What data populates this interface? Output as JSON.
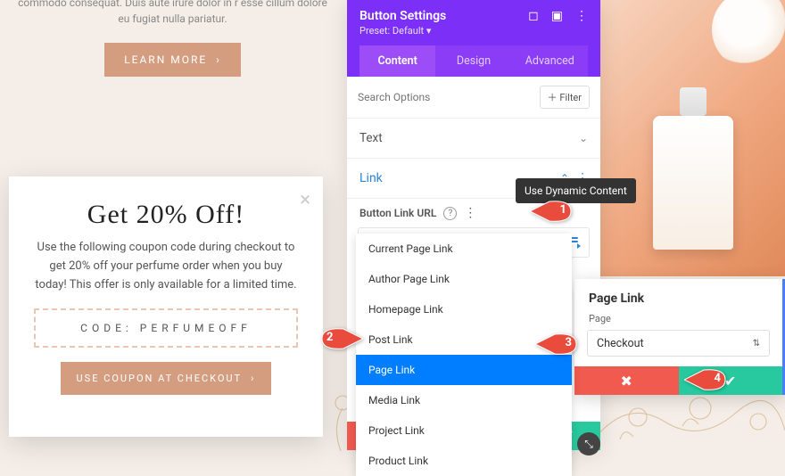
{
  "banner": {
    "lorem": "commodo consequat. Duis aute irure dolor in r\nesse cillum dolore eu fugiat nulla pariatur.",
    "learn_more_label": "LEARN MORE",
    "learn_more_arrow": "›"
  },
  "promo": {
    "title": "Get 20% Off!",
    "body": "Use the following coupon code during checkout to get 20% off your perfume order when you buy today! This offer is only available for a limited time.",
    "coupon_code": "CODE: PERFUMEOFF",
    "cta_label": "USE COUPON AT CHECKOUT",
    "cta_arrow": "›"
  },
  "panel": {
    "title": "Button Settings",
    "preset": "Preset: Default ▾",
    "tabs": {
      "content": "Content",
      "design": "Design",
      "advanced": "Advanced"
    },
    "search_placeholder": "Search Options",
    "filter_label": "＋ Filter",
    "options": {
      "text": "Text",
      "link": "Link"
    },
    "url_label": "Button Link URL",
    "tooltip": "Use Dynamic Content",
    "dropdown": [
      "Current Page Link",
      "Author Page Link",
      "Homepage Link",
      "Post Link",
      "Page Link",
      "Media Link",
      "Project Link",
      "Product Link"
    ],
    "dropdown_selected_index": 4
  },
  "page_link_panel": {
    "title": "Page Link",
    "label": "Page",
    "selected": "Checkout"
  },
  "steps": [
    "1",
    "2",
    "3",
    "4"
  ]
}
